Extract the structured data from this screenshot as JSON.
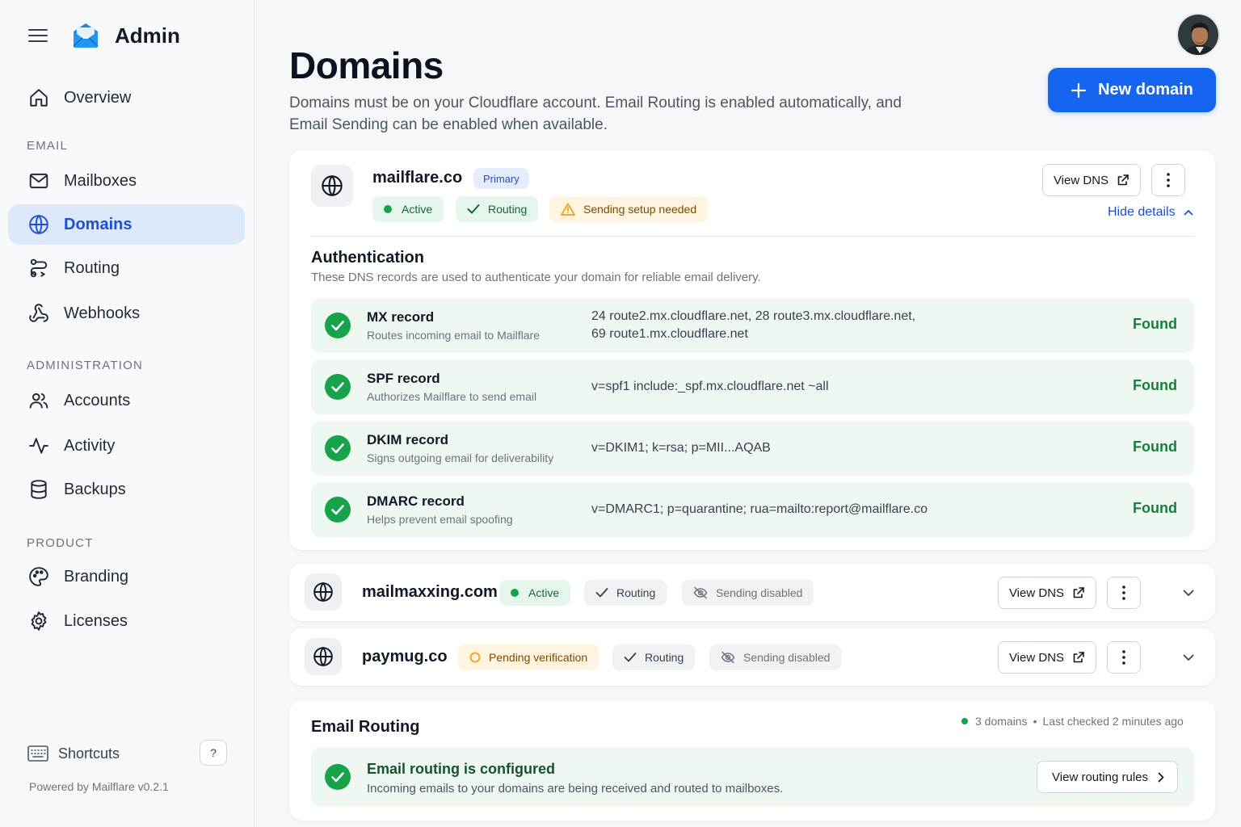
{
  "app": {
    "title": "Admin"
  },
  "sidebar": {
    "overview": "Overview",
    "sections": {
      "email": "EMAIL",
      "administration": "ADMINISTRATION",
      "product": "PRODUCT"
    },
    "items": [
      {
        "label": "Mailboxes",
        "icon": "mail-icon"
      },
      {
        "label": "Domains",
        "icon": "globe-icon",
        "active": true
      },
      {
        "label": "Routing",
        "icon": "routing-icon"
      },
      {
        "label": "Webhooks",
        "icon": "webhook-icon"
      },
      {
        "label": "Accounts",
        "icon": "users-icon"
      },
      {
        "label": "Activity",
        "icon": "activity-icon"
      },
      {
        "label": "Backups",
        "icon": "database-icon"
      },
      {
        "label": "Branding",
        "icon": "palette-icon"
      },
      {
        "label": "Licenses",
        "icon": "gear-icon"
      }
    ],
    "shortcuts": {
      "label": "Shortcuts",
      "key": "?"
    },
    "powered_by": "Powered by Mailflare v0.2.1"
  },
  "header": {
    "title": "Domains",
    "subtitle": "Domains must be on your Cloudflare account. Email Routing is enabled automatically, and Email Sending can be enabled when available.",
    "new_button": "New domain"
  },
  "domains": [
    {
      "name": "mailflare.co",
      "primary_badge": "Primary",
      "badges": [
        "Active",
        "Routing",
        "Sending setup needed"
      ],
      "view_dns": "View DNS",
      "hide_details": "Hide details",
      "auth": {
        "title": "Authentication",
        "subtitle": "These DNS records are used to authenticate your domain for reliable email delivery.",
        "records": [
          {
            "name": "MX record",
            "desc": "Routes incoming email to Mailflare",
            "value_line1": "24 route2.mx.cloudflare.net, 28 route3.mx.cloudflare.net,",
            "value_line2": "69 route1.mx.cloudflare.net",
            "status": "Found"
          },
          {
            "name": "SPF record",
            "desc": "Authorizes Mailflare to send email",
            "value_line1": "v=spf1 include:_spf.mx.cloudflare.net ~all",
            "status": "Found"
          },
          {
            "name": "DKIM record",
            "desc": "Signs outgoing email for deliverability",
            "value_line1": "v=DKIM1; k=rsa; p=MII...AQAB",
            "status": "Found"
          },
          {
            "name": "DMARC record",
            "desc": "Helps prevent email spoofing",
            "value_line1": "v=DMARC1; p=quarantine; rua=mailto:report@mailflare.co",
            "status": "Found"
          }
        ]
      }
    },
    {
      "name": "mailmaxxing.com",
      "badges": [
        "Active",
        "Routing",
        "Sending disabled"
      ],
      "view_dns": "View DNS"
    },
    {
      "name": "paymug.co",
      "badges": [
        "Pending verification",
        "Routing",
        "Sending disabled"
      ],
      "view_dns": "View DNS"
    }
  ],
  "email_routing": {
    "title": "Email Routing",
    "meta_count": "3 domains",
    "meta_sep": "•",
    "meta_checked": "Last checked 2 minutes ago",
    "status_title": "Email routing is configured",
    "status_desc": "Incoming emails to your domains are being received and routed to mailboxes.",
    "button": "View routing rules"
  },
  "colors": {
    "accent": "#1565f0",
    "success": "#15803d",
    "warning": "#f59e0b",
    "active_nav_bg": "#dde8fb"
  }
}
